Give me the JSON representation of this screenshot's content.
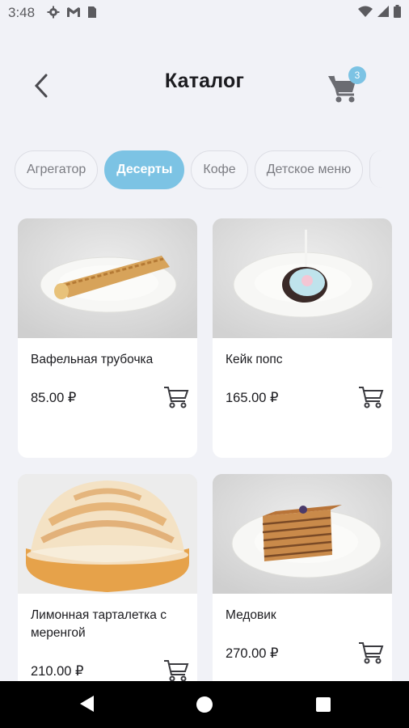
{
  "status_bar": {
    "time": "3:48"
  },
  "header": {
    "title": "Каталог",
    "cart_count": "3"
  },
  "tabs": [
    {
      "label": "Агрегатор",
      "active": false
    },
    {
      "label": "Десерты",
      "active": true
    },
    {
      "label": "Кофе",
      "active": false
    },
    {
      "label": "Детское меню",
      "active": false
    }
  ],
  "products": [
    {
      "name": "Вафельная трубочка",
      "price": "85.00 ₽"
    },
    {
      "name": "Кейк попс",
      "price": "165.00 ₽"
    },
    {
      "name": "Лимонная тарталетка с меренгой",
      "price": "210.00 ₽"
    },
    {
      "name": "Медовик",
      "price": "270.00 ₽"
    }
  ],
  "colors": {
    "accent": "#7cc3e4",
    "background": "#f1f2f7",
    "card": "#ffffff"
  }
}
